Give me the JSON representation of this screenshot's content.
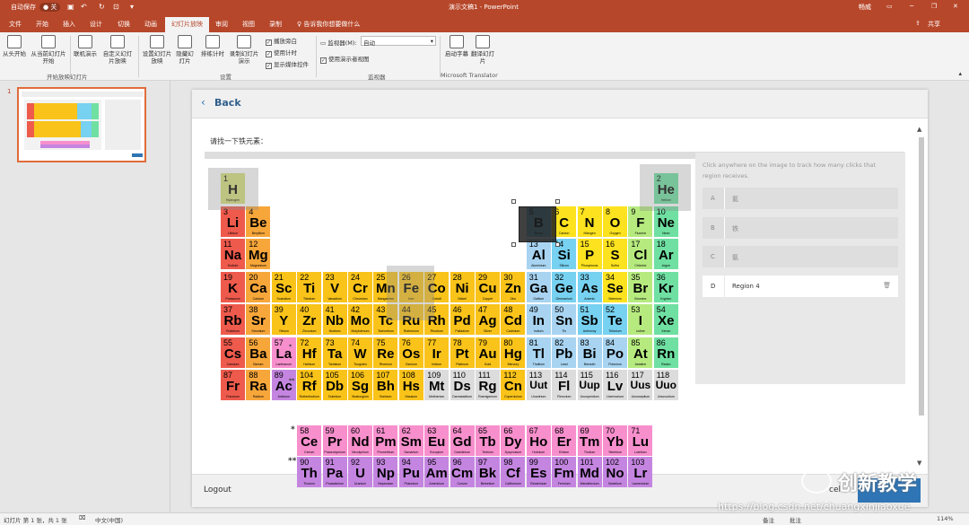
{
  "titlebar": {
    "autosave": "自动保存",
    "off": "● 关",
    "doc_title": "演示文稿1 - PowerPoint",
    "user": "畅威"
  },
  "tabs": [
    "文件",
    "开始",
    "插入",
    "设计",
    "切换",
    "动画",
    "幻灯片放映",
    "审阅",
    "视图",
    "录制",
    "♀ 告诉我你想要做什么"
  ],
  "share": "共享",
  "ribbon": {
    "buttons": [
      {
        "label": "从头开始",
        "icon": "play-start-icon"
      },
      {
        "label": "从当前幻灯片开始",
        "icon": "play-current-icon"
      },
      {
        "label": "联机演示",
        "icon": "present-online-icon"
      },
      {
        "label": "自定义幻灯片放映",
        "icon": "custom-show-icon"
      },
      {
        "label": "设置幻灯片放映",
        "icon": "setup-show-icon"
      },
      {
        "label": "隐藏幻灯片",
        "icon": "hide-slide-icon"
      },
      {
        "label": "排练计时",
        "icon": "rehearse-timings-icon"
      },
      {
        "label": "录制幻灯片演示",
        "icon": "record-show-icon"
      },
      {
        "label": "启动字幕",
        "icon": "subtitles-icon"
      },
      {
        "label": "翻译幻灯片",
        "icon": "translate-icon"
      }
    ],
    "checks": [
      "播放旁白",
      "使用计时",
      "显示媒体控件",
      "使用演示者视图"
    ],
    "monitor_label": "监视器(M):",
    "monitor_value": "自动",
    "groups": [
      "开始放映幻灯片",
      "设置",
      "监视器",
      "Microsoft Translator"
    ]
  },
  "thumb": {
    "number": "1"
  },
  "slide": {
    "back": "Back",
    "prompt": "请找一下铁元素：",
    "panel_hint": "Click anywhere on the image to track how many clicks that region receives.",
    "regions": [
      {
        "letter": "A",
        "name": "氦"
      },
      {
        "letter": "B",
        "name": "铁"
      },
      {
        "letter": "C",
        "name": "氨"
      },
      {
        "letter": "D",
        "name": "Region 4"
      }
    ],
    "logout": "Logout",
    "cancel": "cel"
  },
  "watermark": {
    "logo_text": "创新教学",
    "url": "https://blog.csdn.net/chuangxinjiaoxue"
  },
  "status": {
    "slide_info": "幻灯片 第 1 张，共 1 张",
    "lang": "中文(中国)",
    "notes": "备注",
    "comments": "批注",
    "zoom": "114%"
  },
  "colors": {
    "accent": "#b7472a",
    "alkali": "#ee5a4c",
    "alkaline": "#f7a63a",
    "transition": "#f9c31a",
    "metal": "#a8d4f1",
    "metalloid": "#77d1f0",
    "nonmetal": "#fce21f",
    "halogen": "#b6ea7f",
    "noble": "#6fe0a2",
    "lanth": "#f78fcd",
    "actin": "#c485e0",
    "unknown": "#dcdcdc",
    "hydrogen": "#d8e07c"
  },
  "periodic_table": [
    {
      "n": "1",
      "s": "H",
      "nm": "Hydrogen",
      "c": "hydrogen"
    },
    {
      "n": "2",
      "s": "He",
      "nm": "Helium",
      "c": "noble"
    },
    {
      "n": "3",
      "s": "Li",
      "nm": "Lithium",
      "c": "alkali"
    },
    {
      "n": "4",
      "s": "Be",
      "nm": "Beryllium",
      "c": "alkaline"
    },
    {
      "n": "5",
      "s": "B",
      "nm": "Boron",
      "c": "metalloid"
    },
    {
      "n": "6",
      "s": "C",
      "nm": "Carbon",
      "c": "nonmetal"
    },
    {
      "n": "7",
      "s": "N",
      "nm": "Nitrogen",
      "c": "nonmetal"
    },
    {
      "n": "8",
      "s": "O",
      "nm": "Oxygen",
      "c": "nonmetal"
    },
    {
      "n": "9",
      "s": "F",
      "nm": "Fluorine",
      "c": "halogen"
    },
    {
      "n": "10",
      "s": "Ne",
      "nm": "Neon",
      "c": "noble"
    },
    {
      "n": "11",
      "s": "Na",
      "nm": "Sodium",
      "c": "alkali"
    },
    {
      "n": "12",
      "s": "Mg",
      "nm": "Magnesium",
      "c": "alkaline"
    },
    {
      "n": "13",
      "s": "Al",
      "nm": "Aluminium",
      "c": "metal"
    },
    {
      "n": "14",
      "s": "Si",
      "nm": "Silicon",
      "c": "metalloid"
    },
    {
      "n": "15",
      "s": "P",
      "nm": "Phosphorus",
      "c": "nonmetal"
    },
    {
      "n": "16",
      "s": "S",
      "nm": "Sulfur",
      "c": "nonmetal"
    },
    {
      "n": "17",
      "s": "Cl",
      "nm": "Chlorine",
      "c": "halogen"
    },
    {
      "n": "18",
      "s": "Ar",
      "nm": "Argon",
      "c": "noble"
    },
    {
      "n": "19",
      "s": "K",
      "nm": "Potassium",
      "c": "alkali"
    },
    {
      "n": "20",
      "s": "Ca",
      "nm": "Calcium",
      "c": "alkaline"
    },
    {
      "n": "21",
      "s": "Sc",
      "nm": "Scandium",
      "c": "transition"
    },
    {
      "n": "22",
      "s": "Ti",
      "nm": "Titanium",
      "c": "transition"
    },
    {
      "n": "23",
      "s": "V",
      "nm": "Vanadium",
      "c": "transition"
    },
    {
      "n": "24",
      "s": "Cr",
      "nm": "Chromium",
      "c": "transition"
    },
    {
      "n": "25",
      "s": "Mn",
      "nm": "Manganese",
      "c": "transition"
    },
    {
      "n": "26",
      "s": "Fe",
      "nm": "Iron",
      "c": "transition"
    },
    {
      "n": "27",
      "s": "Co",
      "nm": "Cobalt",
      "c": "transition"
    },
    {
      "n": "28",
      "s": "Ni",
      "nm": "Nickel",
      "c": "transition"
    },
    {
      "n": "29",
      "s": "Cu",
      "nm": "Copper",
      "c": "transition"
    },
    {
      "n": "30",
      "s": "Zn",
      "nm": "Zinc",
      "c": "transition"
    },
    {
      "n": "31",
      "s": "Ga",
      "nm": "Gallium",
      "c": "metal"
    },
    {
      "n": "32",
      "s": "Ge",
      "nm": "Germanium",
      "c": "metalloid"
    },
    {
      "n": "33",
      "s": "As",
      "nm": "Arsenic",
      "c": "metalloid"
    },
    {
      "n": "34",
      "s": "Se",
      "nm": "Selenium",
      "c": "nonmetal"
    },
    {
      "n": "35",
      "s": "Br",
      "nm": "Bromine",
      "c": "halogen"
    },
    {
      "n": "36",
      "s": "Kr",
      "nm": "Krypton",
      "c": "noble"
    },
    {
      "n": "37",
      "s": "Rb",
      "nm": "Rubidium",
      "c": "alkali"
    },
    {
      "n": "38",
      "s": "Sr",
      "nm": "Strontium",
      "c": "alkaline"
    },
    {
      "n": "39",
      "s": "Y",
      "nm": "Yttrium",
      "c": "transition"
    },
    {
      "n": "40",
      "s": "Zr",
      "nm": "Zirconium",
      "c": "transition"
    },
    {
      "n": "41",
      "s": "Nb",
      "nm": "Niobium",
      "c": "transition"
    },
    {
      "n": "42",
      "s": "Mo",
      "nm": "Molybdenum",
      "c": "transition"
    },
    {
      "n": "43",
      "s": "Tc",
      "nm": "Technetium",
      "c": "transition"
    },
    {
      "n": "44",
      "s": "Ru",
      "nm": "Ruthenium",
      "c": "transition"
    },
    {
      "n": "45",
      "s": "Rh",
      "nm": "Rhodium",
      "c": "transition"
    },
    {
      "n": "46",
      "s": "Pd",
      "nm": "Palladium",
      "c": "transition"
    },
    {
      "n": "47",
      "s": "Ag",
      "nm": "Silver",
      "c": "transition"
    },
    {
      "n": "48",
      "s": "Cd",
      "nm": "Cadmium",
      "c": "transition"
    },
    {
      "n": "49",
      "s": "In",
      "nm": "Indium",
      "c": "metal"
    },
    {
      "n": "50",
      "s": "Sn",
      "nm": "Tin",
      "c": "metal"
    },
    {
      "n": "51",
      "s": "Sb",
      "nm": "Antimony",
      "c": "metalloid"
    },
    {
      "n": "52",
      "s": "Te",
      "nm": "Tellurium",
      "c": "metalloid"
    },
    {
      "n": "53",
      "s": "I",
      "nm": "Iodine",
      "c": "halogen"
    },
    {
      "n": "54",
      "s": "Xe",
      "nm": "Xenon",
      "c": "noble"
    },
    {
      "n": "55",
      "s": "Cs",
      "nm": "Caesium",
      "c": "alkali"
    },
    {
      "n": "56",
      "s": "Ba",
      "nm": "Barium",
      "c": "alkaline"
    },
    {
      "n": "57",
      "s": "La",
      "nm": "Lanthanum",
      "c": "lanth"
    },
    {
      "n": "72",
      "s": "Hf",
      "nm": "Hafnium",
      "c": "transition"
    },
    {
      "n": "73",
      "s": "Ta",
      "nm": "Tantalum",
      "c": "transition"
    },
    {
      "n": "74",
      "s": "W",
      "nm": "Tungsten",
      "c": "transition"
    },
    {
      "n": "75",
      "s": "Re",
      "nm": "Rhenium",
      "c": "transition"
    },
    {
      "n": "76",
      "s": "Os",
      "nm": "Osmium",
      "c": "transition"
    },
    {
      "n": "77",
      "s": "Ir",
      "nm": "Iridium",
      "c": "transition"
    },
    {
      "n": "78",
      "s": "Pt",
      "nm": "Platinum",
      "c": "transition"
    },
    {
      "n": "79",
      "s": "Au",
      "nm": "Gold",
      "c": "transition"
    },
    {
      "n": "80",
      "s": "Hg",
      "nm": "Mercury",
      "c": "transition"
    },
    {
      "n": "81",
      "s": "Tl",
      "nm": "Thallium",
      "c": "metal"
    },
    {
      "n": "82",
      "s": "Pb",
      "nm": "Lead",
      "c": "metal"
    },
    {
      "n": "83",
      "s": "Bi",
      "nm": "Bismuth",
      "c": "metal"
    },
    {
      "n": "84",
      "s": "Po",
      "nm": "Polonium",
      "c": "metal"
    },
    {
      "n": "85",
      "s": "At",
      "nm": "Astatine",
      "c": "halogen"
    },
    {
      "n": "86",
      "s": "Rn",
      "nm": "Radon",
      "c": "noble"
    },
    {
      "n": "87",
      "s": "Fr",
      "nm": "Francium",
      "c": "alkali"
    },
    {
      "n": "88",
      "s": "Ra",
      "nm": "Radium",
      "c": "alkaline"
    },
    {
      "n": "89",
      "s": "Ac",
      "nm": "Actinium",
      "c": "actin"
    },
    {
      "n": "104",
      "s": "Rf",
      "nm": "Rutherfordium",
      "c": "transition"
    },
    {
      "n": "105",
      "s": "Db",
      "nm": "Dubnium",
      "c": "transition"
    },
    {
      "n": "106",
      "s": "Sg",
      "nm": "Seaborgium",
      "c": "transition"
    },
    {
      "n": "107",
      "s": "Bh",
      "nm": "Bohrium",
      "c": "transition"
    },
    {
      "n": "108",
      "s": "Hs",
      "nm": "Hassium",
      "c": "transition"
    },
    {
      "n": "109",
      "s": "Mt",
      "nm": "Meitnerium",
      "c": "unknown"
    },
    {
      "n": "110",
      "s": "Ds",
      "nm": "Darmstadtium",
      "c": "unknown"
    },
    {
      "n": "111",
      "s": "Rg",
      "nm": "Roentgenium",
      "c": "unknown"
    },
    {
      "n": "112",
      "s": "Cn",
      "nm": "Copernicium",
      "c": "transition"
    },
    {
      "n": "113",
      "s": "Uut",
      "nm": "Ununtrium",
      "c": "unknown"
    },
    {
      "n": "114",
      "s": "Fl",
      "nm": "Flerovium",
      "c": "unknown"
    },
    {
      "n": "115",
      "s": "Uup",
      "nm": "Ununpentium",
      "c": "unknown"
    },
    {
      "n": "116",
      "s": "Lv",
      "nm": "Livermorium",
      "c": "unknown"
    },
    {
      "n": "117",
      "s": "Uus",
      "nm": "Ununseptium",
      "c": "unknown"
    },
    {
      "n": "118",
      "s": "Uuo",
      "nm": "Ununoctium",
      "c": "unknown"
    },
    {
      "n": "58",
      "s": "Ce",
      "nm": "Cerium",
      "c": "lanth"
    },
    {
      "n": "59",
      "s": "Pr",
      "nm": "Praseodymium",
      "c": "lanth"
    },
    {
      "n": "60",
      "s": "Nd",
      "nm": "Neodymium",
      "c": "lanth"
    },
    {
      "n": "61",
      "s": "Pm",
      "nm": "Promethium",
      "c": "lanth"
    },
    {
      "n": "62",
      "s": "Sm",
      "nm": "Samarium",
      "c": "lanth"
    },
    {
      "n": "63",
      "s": "Eu",
      "nm": "Europium",
      "c": "lanth"
    },
    {
      "n": "64",
      "s": "Gd",
      "nm": "Gadolinium",
      "c": "lanth"
    },
    {
      "n": "65",
      "s": "Tb",
      "nm": "Terbium",
      "c": "lanth"
    },
    {
      "n": "66",
      "s": "Dy",
      "nm": "Dysprosium",
      "c": "lanth"
    },
    {
      "n": "67",
      "s": "Ho",
      "nm": "Holmium",
      "c": "lanth"
    },
    {
      "n": "68",
      "s": "Er",
      "nm": "Erbium",
      "c": "lanth"
    },
    {
      "n": "69",
      "s": "Tm",
      "nm": "Thulium",
      "c": "lanth"
    },
    {
      "n": "70",
      "s": "Yb",
      "nm": "Ytterbium",
      "c": "lanth"
    },
    {
      "n": "71",
      "s": "Lu",
      "nm": "Lutetium",
      "c": "lanth"
    },
    {
      "n": "90",
      "s": "Th",
      "nm": "Thorium",
      "c": "actin"
    },
    {
      "n": "91",
      "s": "Pa",
      "nm": "Protactinium",
      "c": "actin"
    },
    {
      "n": "92",
      "s": "U",
      "nm": "Uranium",
      "c": "actin"
    },
    {
      "n": "93",
      "s": "Np",
      "nm": "Neptunium",
      "c": "actin"
    },
    {
      "n": "94",
      "s": "Pu",
      "nm": "Plutonium",
      "c": "actin"
    },
    {
      "n": "95",
      "s": "Am",
      "nm": "Americium",
      "c": "actin"
    },
    {
      "n": "96",
      "s": "Cm",
      "nm": "Curium",
      "c": "actin"
    },
    {
      "n": "97",
      "s": "Bk",
      "nm": "Berkelium",
      "c": "actin"
    },
    {
      "n": "98",
      "s": "Cf",
      "nm": "Californium",
      "c": "actin"
    },
    {
      "n": "99",
      "s": "Es",
      "nm": "Einsteinium",
      "c": "actin"
    },
    {
      "n": "100",
      "s": "Fm",
      "nm": "Fermium",
      "c": "actin"
    },
    {
      "n": "101",
      "s": "Md",
      "nm": "Mendelevium",
      "c": "actin"
    },
    {
      "n": "102",
      "s": "No",
      "nm": "Nobelium",
      "c": "actin"
    },
    {
      "n": "103",
      "s": "Lr",
      "nm": "Lawrencium",
      "c": "actin"
    }
  ]
}
